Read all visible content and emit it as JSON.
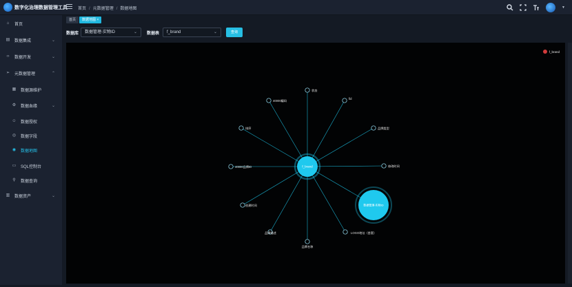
{
  "app": {
    "title": "数字化治理数据管理工具"
  },
  "breadcrumb": [
    "首页",
    "元数据管理",
    "数据地图"
  ],
  "header": {
    "icons": [
      "search-icon",
      "fullscreen-icon",
      "font-size-icon",
      "user-avatar"
    ]
  },
  "sidebar": {
    "items": [
      {
        "label": "首页",
        "icon": "home-icon"
      },
      {
        "label": "数据集成",
        "icon": "database-icon",
        "expandable": true
      },
      {
        "label": "数据开发",
        "icon": "code-icon",
        "expandable": true
      },
      {
        "label": "元数据管理",
        "icon": "send-icon",
        "expandable": true,
        "expanded": true
      },
      {
        "label": "数据源维护",
        "icon": "server-icon"
      },
      {
        "label": "数据血缘",
        "icon": "gear-icon",
        "expandable": true
      },
      {
        "label": "数据授权",
        "icon": "user-icon"
      },
      {
        "label": "数据字段",
        "icon": "field-icon"
      },
      {
        "label": "数据地图",
        "icon": "map-icon",
        "active": true
      },
      {
        "label": "SQL控制台",
        "icon": "monitor-icon"
      },
      {
        "label": "数据查询",
        "icon": "search-icon"
      },
      {
        "label": "数据资产",
        "icon": "asset-icon",
        "expandable": true
      }
    ]
  },
  "tags": {
    "home": "首页",
    "current": "数据地图"
  },
  "filter": {
    "db_label": "数据库",
    "db_value": "数据管理-实物ID",
    "table_label": "数据表",
    "table_value": "f_brand",
    "query_button": "查询"
  },
  "graph": {
    "legend": "f_brand",
    "legend_color": "#d23b3b",
    "center": "f_brand",
    "secondary": "数据管理-实物ID",
    "fields": [
      "状态",
      "fid",
      "品牌类型",
      "修改时间",
      "LOGO地址（首套）",
      "品牌名称",
      "品牌描述",
      "创建时间",
      "40000品牌ID",
      "排序",
      "40000编码"
    ]
  },
  "colors": {
    "accent": "#25c0e8",
    "node": "#1fc9ee",
    "edge": "#1ab0d0"
  }
}
